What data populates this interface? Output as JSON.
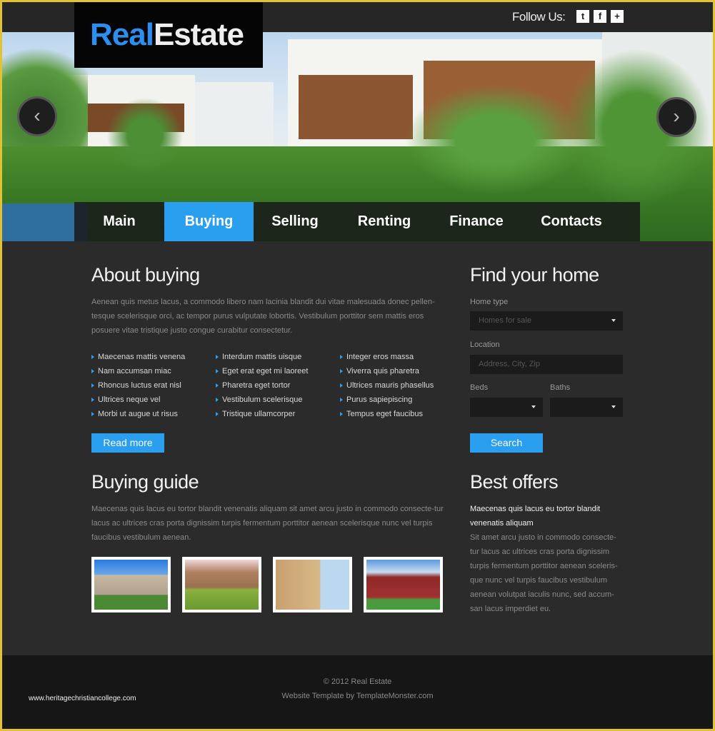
{
  "header": {
    "logo_part1": "Real",
    "logo_part2": "Estate",
    "follow_label": "Follow Us:",
    "social": [
      {
        "icon": "twitter-icon",
        "glyph": "t"
      },
      {
        "icon": "facebook-icon",
        "glyph": "f"
      },
      {
        "icon": "plus-icon",
        "glyph": "+"
      }
    ]
  },
  "slider": {
    "prev_glyph": "‹",
    "next_glyph": "›"
  },
  "nav": [
    {
      "label": "Main"
    },
    {
      "label": "Buying",
      "active": true
    },
    {
      "label": "Selling"
    },
    {
      "label": "Renting"
    },
    {
      "label": "Finance"
    },
    {
      "label": "Contacts"
    }
  ],
  "about": {
    "title": "About buying",
    "text": "Aenean quis metus lacus, a commodo libero nam lacinia blandit dui vitae malesuada donec pellen-tesque scelerisque orci, ac tempor purus vulputate lobortis. Vestibulum porttitor sem mattis eros posuere vitae tristique justo congue curabitur consectetur.",
    "columns": [
      [
        "Maecenas mattis venena",
        "Nam accumsan miac",
        "Rhoncus luctus erat nisl",
        "Ultrices neque vel",
        "Morbi ut augue ut risus"
      ],
      [
        "Interdum mattis uisque",
        "Eget erat eget mi laoreet",
        "Pharetra eget tortor",
        "Vestibulum scelerisque",
        "Tristique ullamcorper"
      ],
      [
        "Integer eros massa",
        "Viverra quis pharetra",
        "Ultrices mauris phasellus",
        "Purus sapiepiscing",
        "Tempus eget faucibus"
      ]
    ],
    "button": "Read more"
  },
  "find": {
    "title": "Find your home",
    "home_type_label": "Home type",
    "home_type_value": "Homes for sale",
    "location_label": "Location",
    "location_placeholder": "Address, City, Zip",
    "beds_label": "Beds",
    "baths_label": "Baths",
    "button": "Search"
  },
  "guide": {
    "title": "Buying guide",
    "text": "Maecenas quis lacus eu tortor blandit venenatis aliquam sit amet arcu justo in commodo consecte-tur lacus ac ultrices cras porta dignissim turpis fermentum porttitor aenean scelerisque nunc vel turpis faucibus vestibulum aenean."
  },
  "offers": {
    "title": "Best offers",
    "highlight": "Maecenas quis lacus eu tortor blandit venenatis aliquam",
    "text": "Sit amet arcu justo in commodo consecte-tur lacus ac ultrices cras porta dignissim turpis fermentum porttitor aenean sceleris-que nunc vel turpis faucibus vestibulum aenean volutpat iaculis nunc, sed accum-san lacus imperdiet eu."
  },
  "footer": {
    "copyright": "© 2012 Real Estate",
    "credit": "Website Template by TemplateMonster.com",
    "watermark": "www.heritagechristiancollege.com"
  },
  "colors": {
    "accent": "#2a9ff0",
    "background": "#2b2b2b",
    "footer": "#161616",
    "frame": "#e2c232"
  }
}
